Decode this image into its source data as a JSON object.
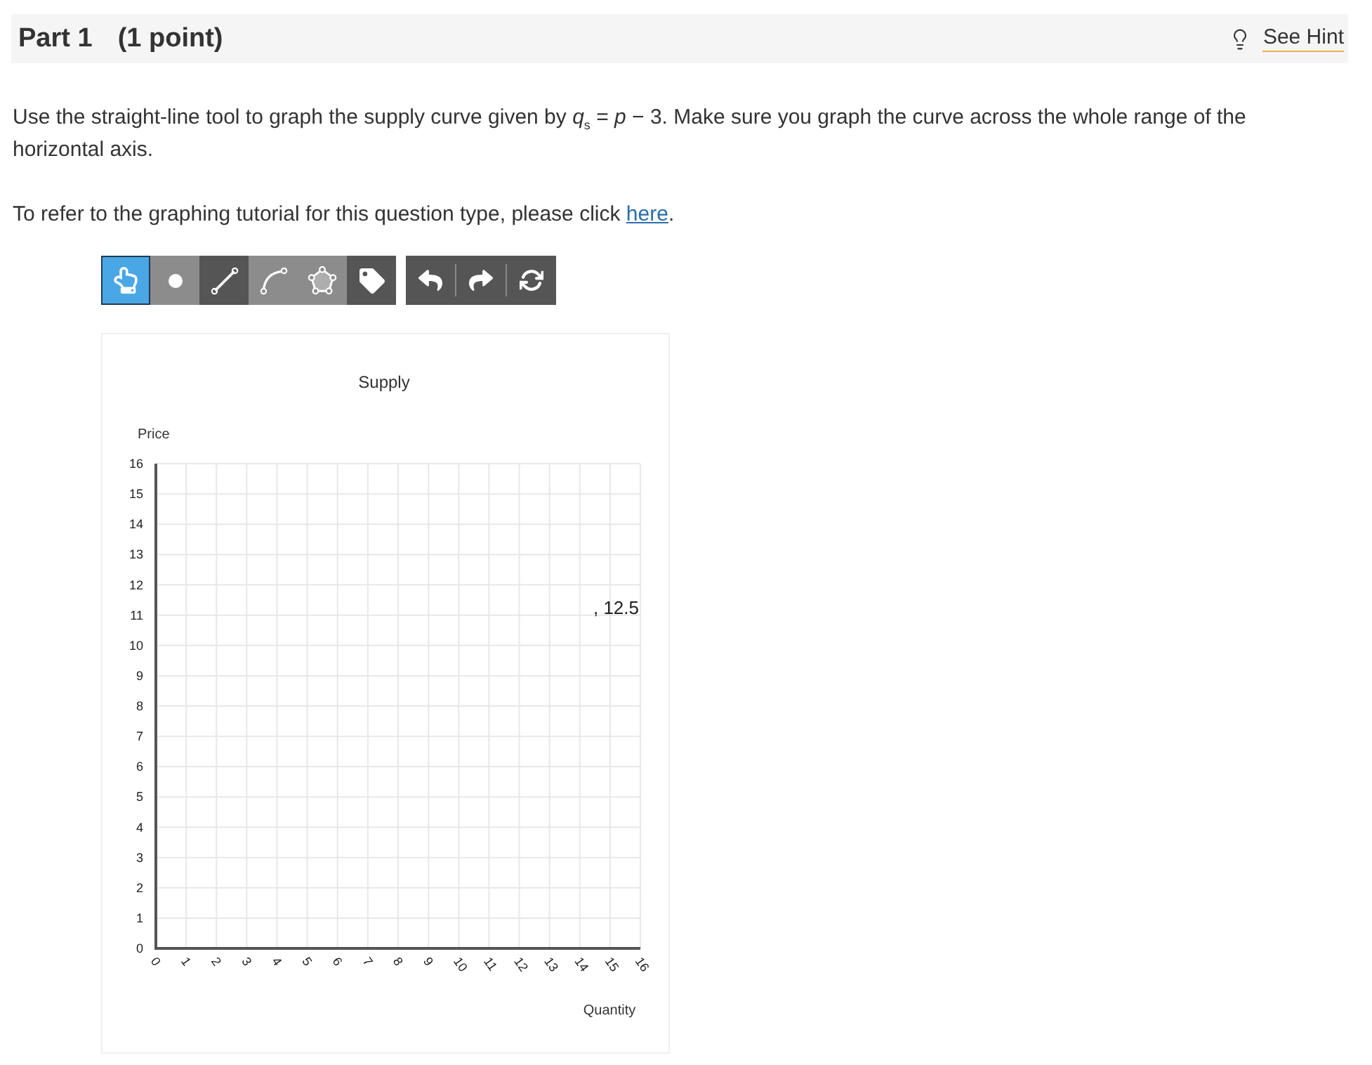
{
  "part": {
    "title": "Part 1",
    "points": "(1 point)"
  },
  "hint": {
    "label": "See Hint"
  },
  "instructions": {
    "prompt": "Use the straight-line tool to graph the supply curve given by *q*$_{s}$ = *p* − 3. Make sure you graph the curve across the whole range of the horizontal axis.",
    "tutorial_text": "To refer to the graphing tutorial for this question type, please click",
    "tutorial_link": "here",
    "tutorial_end": "."
  },
  "toolbar": {
    "tools": [
      {
        "kind": "pointer",
        "selected": true,
        "disabled": false
      },
      {
        "kind": "point",
        "selected": false,
        "disabled": true
      },
      {
        "kind": "line",
        "selected": false,
        "disabled": false
      },
      {
        "kind": "curve",
        "selected": false,
        "disabled": true
      },
      {
        "kind": "polygon",
        "selected": false,
        "disabled": true
      },
      {
        "kind": "label",
        "selected": false,
        "disabled": false
      }
    ],
    "actions": [
      {
        "kind": "undo"
      },
      {
        "kind": "redo"
      },
      {
        "kind": "reset"
      }
    ]
  },
  "graph": {
    "chart_data": {
      "type": "line",
      "title": "Supply",
      "xlabel": "Quantity",
      "ylabel": "Price",
      "xlim": [
        0,
        16
      ],
      "ylim": [
        0,
        16
      ],
      "xticks": [
        0,
        1,
        2,
        3,
        4,
        5,
        6,
        7,
        8,
        9,
        10,
        11,
        12,
        13,
        14,
        15,
        16
      ],
      "yticks": [
        0,
        1,
        2,
        3,
        4,
        5,
        6,
        7,
        8,
        9,
        10,
        11,
        12,
        13,
        14,
        15,
        16
      ],
      "grid": true,
      "annotations": [
        ", 12.5"
      ]
    }
  }
}
